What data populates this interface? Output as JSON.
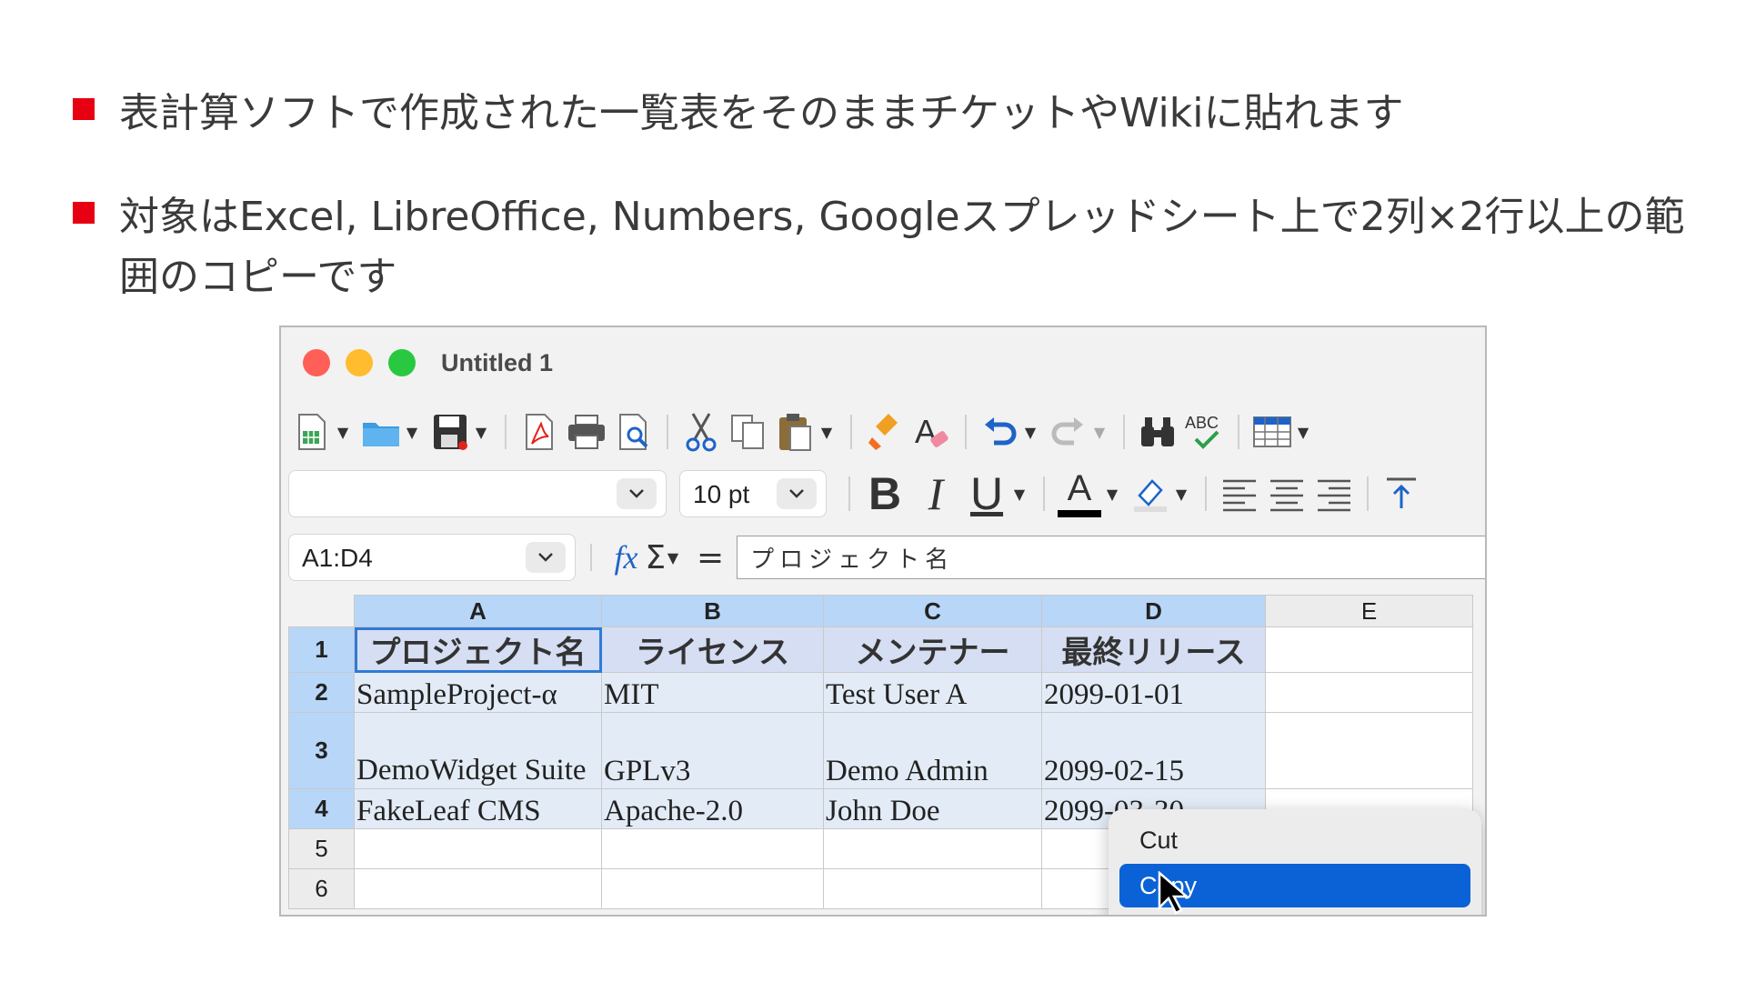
{
  "bullets": [
    {
      "text": "表計算ソフトで作成された一覧表をそのままチケットやWikiに貼れます"
    },
    {
      "text": "対象はExcel, LibreOffice, Numbers, Googleスプレッドシート上で2列×2行以上の範囲のコピーです"
    }
  ],
  "window": {
    "title": "Untitled 1"
  },
  "format_bar": {
    "font_name": "",
    "font_size": "10 pt",
    "bold": "B",
    "italic": "I",
    "underline": "U",
    "font_color": "A"
  },
  "formula_bar": {
    "name_box": "A1:D4",
    "fx": "fx",
    "sum": "Σ",
    "equals": "=",
    "content": "プロジェクト名"
  },
  "sheet": {
    "column_headers": [
      "A",
      "B",
      "C",
      "D",
      "E"
    ],
    "row_headers": [
      "1",
      "2",
      "3",
      "4",
      "5",
      "6"
    ],
    "rows": [
      [
        "プロジェクト名",
        "ライセンス",
        "メンテナー",
        "最終リリース"
      ],
      [
        "SampleProject-α",
        "MIT",
        "Test User A",
        "2099-01-01"
      ],
      [
        "DemoWidget Suite",
        "GPLv3",
        "Demo Admin",
        "2099-02-15"
      ],
      [
        "FakeLeaf CMS",
        "Apache-2.0",
        "John Doe",
        "2099-03-30"
      ]
    ]
  },
  "context_menu": {
    "items": [
      "Cut",
      "Copy"
    ],
    "highlighted": "Copy"
  },
  "colors": {
    "bullet": "#e60012",
    "selection_header": "#b8d6f7",
    "selection_cell": "#e3ecf6",
    "menu_highlight": "#0b62d6"
  }
}
